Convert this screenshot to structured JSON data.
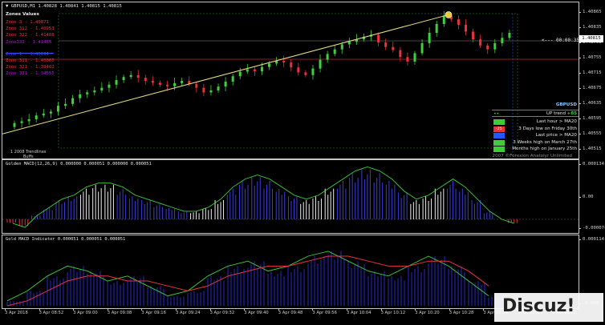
{
  "header": {
    "symbol": "▼ GBPUSD,M1  1.40828  1.40841  1.40815  1.40815",
    "zones_title": "Zones Values",
    "zones": [
      {
        "label": "Zone 3 - 1.40871",
        "color": "#e8323c"
      },
      {
        "label": "Zone 312 - 1.40953",
        "color": "#e8323c"
      },
      {
        "label": "Zone 322 - 1.41488",
        "color": "#e8323c"
      },
      {
        "label": "Zone333 - 1.41485",
        "color": "#b414dc"
      },
      {
        "label": "Zone 1 - 1.40694",
        "color": "#3c4cff"
      },
      {
        "label": "Zone 311 - 1.40060",
        "color": "#e8323c"
      },
      {
        "label": "Zone 321 - 1.39402",
        "color": "#e8323c"
      },
      {
        "label": "Zone 331 - 1.34555",
        "color": "#b414dc"
      }
    ],
    "countdown": "<--- 00:00:35",
    "current_price": "1.40815"
  },
  "price_axis": [
    "1.40865",
    "1.40835",
    "1.40795",
    "1.40755",
    "1.40715",
    "1.40675",
    "1.40635",
    "1.40595",
    "1.40555",
    "1.40515"
  ],
  "panel": {
    "symbol": "GBPUSD",
    "trend_label": "UP trend",
    "trend_value": "+85",
    "rows": [
      {
        "text": "Last hour > MA20",
        "badge": "#3ccd3c"
      },
      {
        "text": "3 Days low on Friday 30th",
        "badge": "#e8323c",
        "badge_text": "-25"
      },
      {
        "text": "Last price > MA20",
        "badge": "#1e5aff"
      },
      {
        "text": "3 Weeks high on March 27th",
        "badge": "#3ccd3c"
      },
      {
        "text": "Months high on January 25th",
        "badge": "#3ccd3c"
      }
    ],
    "footer": "2007 ©Forexion Anatolyr Unlimited"
  },
  "bottom_left_note": "1 2008 Trendlines",
  "bottom_left_note2": "Buffs",
  "macd1": {
    "title": "Golden MACD(12,26,9) 0.000000 0.000051 0.000000 0.000051",
    "axis": [
      "0.000134",
      "0.00",
      "-0.000074"
    ]
  },
  "macd2": {
    "title": "Gold MACD Indicator 0.000051 0.000051 0.000051",
    "axis": [
      "0.000114",
      "-0.000"
    ]
  },
  "time_axis": [
    "3 Apr 2018",
    "3 Apr 08:52",
    "3 Apr 09:00",
    "3 Apr 09:08",
    "3 Apr 09:16",
    "3 Apr 09:24",
    "3 Apr 09:32",
    "3 Apr 09:40",
    "3 Apr 09:48",
    "3 Apr 09:56",
    "3 Apr 10:04",
    "3 Apr 10:12",
    "3 Apr 10:20",
    "3 Apr 10:28",
    "3 Apr 10:36",
    "3 Apr 10:44",
    "3 Apr 10:52"
  ],
  "watermark": "Discuz!",
  "chart_data": {
    "type": "candlestick",
    "symbol": "GBPUSD",
    "timeframe": "M1",
    "x_range": [
      "3 Apr 2018",
      "3 Apr 10:52"
    ],
    "y_range": [
      1.40515,
      1.40865
    ],
    "close_series": [
      1.4058,
      1.40585,
      1.4059,
      1.406,
      1.40605,
      1.4061,
      1.40625,
      1.4063,
      1.40645,
      1.40655,
      1.4066,
      1.40665,
      1.40672,
      1.4068,
      1.40692,
      1.407,
      1.40705,
      1.40698,
      1.4069,
      1.40685,
      1.4068,
      1.40676,
      1.40684,
      1.4069,
      1.40682,
      1.40672,
      1.4066,
      1.40665,
      1.40675,
      1.40688,
      1.40702,
      1.40714,
      1.4072,
      1.40715,
      1.40726,
      1.40735,
      1.40742,
      1.40738,
      1.40725,
      1.40712,
      1.40705,
      1.40722,
      1.40745,
      1.4076,
      1.40772,
      1.40785,
      1.40792,
      1.40798,
      1.40805,
      1.4081,
      1.4079,
      1.40778,
      1.4077,
      1.40752,
      1.4074,
      1.40762,
      1.40788,
      1.40815,
      1.40838,
      1.4086,
      1.4085,
      1.40836,
      1.40818,
      1.40798,
      1.40782,
      1.40772,
      1.40788,
      1.40802,
      1.40815
    ],
    "trendline": {
      "from": 1.40552,
      "to": 1.40862
    },
    "macd1_hist": [
      -1e-05,
      -2e-05,
      1e-05,
      3e-05,
      5e-05,
      6e-05,
      8e-05,
      9e-05,
      9e-05,
      8e-05,
      6e-05,
      5e-05,
      4e-05,
      3e-05,
      2e-05,
      2e-05,
      3e-05,
      5e-05,
      8e-05,
      0.0001,
      0.00011,
      0.0001,
      8e-05,
      6e-05,
      5e-05,
      6e-05,
      8e-05,
      0.0001,
      0.00012,
      0.00013,
      0.00012,
      0.0001,
      7e-05,
      5e-05,
      6e-05,
      8e-05,
      0.0001,
      8e-05,
      5e-05,
      2e-05,
      0.0,
      -1e-05
    ],
    "macd2_fast": [
      1e-05,
      3e-05,
      6e-05,
      8e-05,
      7e-05,
      5e-05,
      6e-05,
      4e-05,
      2e-05,
      3e-05,
      6e-05,
      8e-05,
      9e-05,
      7e-05,
      8e-05,
      0.0001,
      0.00011,
      9e-05,
      7e-05,
      6e-05,
      8e-05,
      0.0001,
      8e-05,
      5e-05,
      2e-05
    ],
    "macd2_slow": [
      0.0,
      1e-05,
      3e-05,
      5e-05,
      6e-05,
      6e-05,
      5e-05,
      5e-05,
      4e-05,
      3e-05,
      4e-05,
      6e-05,
      7e-05,
      8e-05,
      8e-05,
      9e-05,
      0.0001,
      0.0001,
      9e-05,
      8e-05,
      8e-05,
      9e-05,
      9e-05,
      7e-05,
      4e-05
    ]
  }
}
